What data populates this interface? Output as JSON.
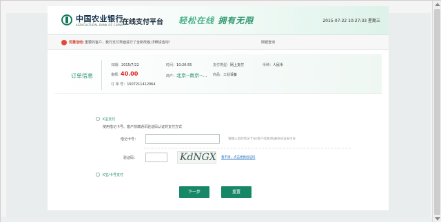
{
  "header": {
    "bank_name": "中国农业银行",
    "bank_name_en": "AGRICULTURAL BANK OF CHINA",
    "platform": "在线支付平台",
    "slogan_1": "轻松在线",
    "slogan_2": "拥有无限",
    "datetime": "2015-07-22 10:27:33 星期三"
  },
  "notice": {
    "label": "优惠活动：",
    "text": "重要的客户，我行支付界面进行了全新改版,详细请咨询!",
    "link": "网银查询"
  },
  "order": {
    "title": "订单信息",
    "date_label": "日期：",
    "date": "2015/7/22",
    "time_label": "时间：",
    "time": "10:26:55",
    "paytype_label": "支付类型：",
    "paytype": "网上支付",
    "currency_label": "币种：",
    "currency": "人民币",
    "amount_label": "金额：",
    "amount": "40.00",
    "merchant_label": "商户：",
    "merchant": "北京--南京--...",
    "goods_label": "商品：",
    "goods": "工业设备",
    "order_no_label": "订 单 号：",
    "order_no": "1507211412064"
  },
  "payment": {
    "option_card": "K宝支付",
    "option_card_desc": "使用借记卡号、客户前端通讯验证码认证的支付方式",
    "card_label": "借记卡号：",
    "card_value": "",
    "card_hint": "请输入您的借记卡号(客户前端)和通讯号证支付号",
    "captcha_label": "验证码：",
    "captcha_value": "",
    "captcha_text": "KdNGX",
    "captcha_refresh": "看不清，点击更换验证码",
    "option_other": "K宝/卡号支付"
  },
  "buttons": {
    "next": "下一步",
    "reset": "重置"
  },
  "colors": {
    "brand_green": "#168767",
    "accent_green": "#1e8c6a",
    "amount_red": "#e02020"
  }
}
